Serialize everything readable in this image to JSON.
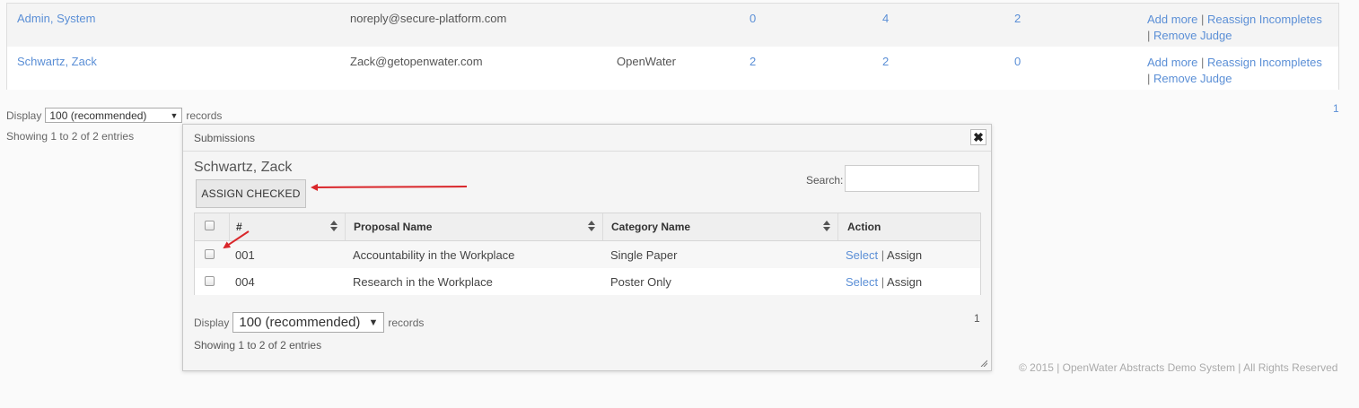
{
  "judges": [
    {
      "name": "Admin, System",
      "email": "noreply@secure-platform.com",
      "organization": "",
      "count1": "0",
      "count2": "4",
      "count3": "2",
      "action_add": "Add more",
      "action_reassign": "Reassign Incompletes",
      "action_remove": "Remove Judge"
    },
    {
      "name": "Schwartz, Zack",
      "email": "Zack@getopenwater.com",
      "organization": "OpenWater",
      "count1": "2",
      "count2": "2",
      "count3": "0",
      "action_add": "Add more",
      "action_reassign": "Reassign Incompletes",
      "action_remove": "Remove Judge"
    }
  ],
  "background_pager": {
    "display_label": "Display",
    "display_value": "100 (recommended)",
    "records_label": "records",
    "showing": "Showing 1 to 2 of 2 entries",
    "page": "1"
  },
  "footer": "© 2015 | OpenWater Abstracts Demo System | All Rights Reserved",
  "modal": {
    "title": "Submissions",
    "close": "✖",
    "judge_name": "Schwartz, Zack",
    "assign_button": "ASSIGN CHECKED",
    "search_label": "Search:",
    "search_value": "",
    "columns": [
      "#",
      "Proposal Name",
      "Category Name",
      "Action"
    ],
    "rows": [
      {
        "num": "001",
        "proposal": "Accountability in the Workplace",
        "category": "Single Paper",
        "select": "Select",
        "assign": "Assign"
      },
      {
        "num": "004",
        "proposal": "Research in the Workplace",
        "category": "Poster Only",
        "select": "Select",
        "assign": "Assign"
      }
    ],
    "display_label": "Display",
    "display_value": "100 (recommended)",
    "records_label": "records",
    "page": "1",
    "showing": "Showing 1 to 2 of 2 entries"
  },
  "colors": {
    "link": "#5b8fd6",
    "annotation_arrow": "#d9262a"
  }
}
